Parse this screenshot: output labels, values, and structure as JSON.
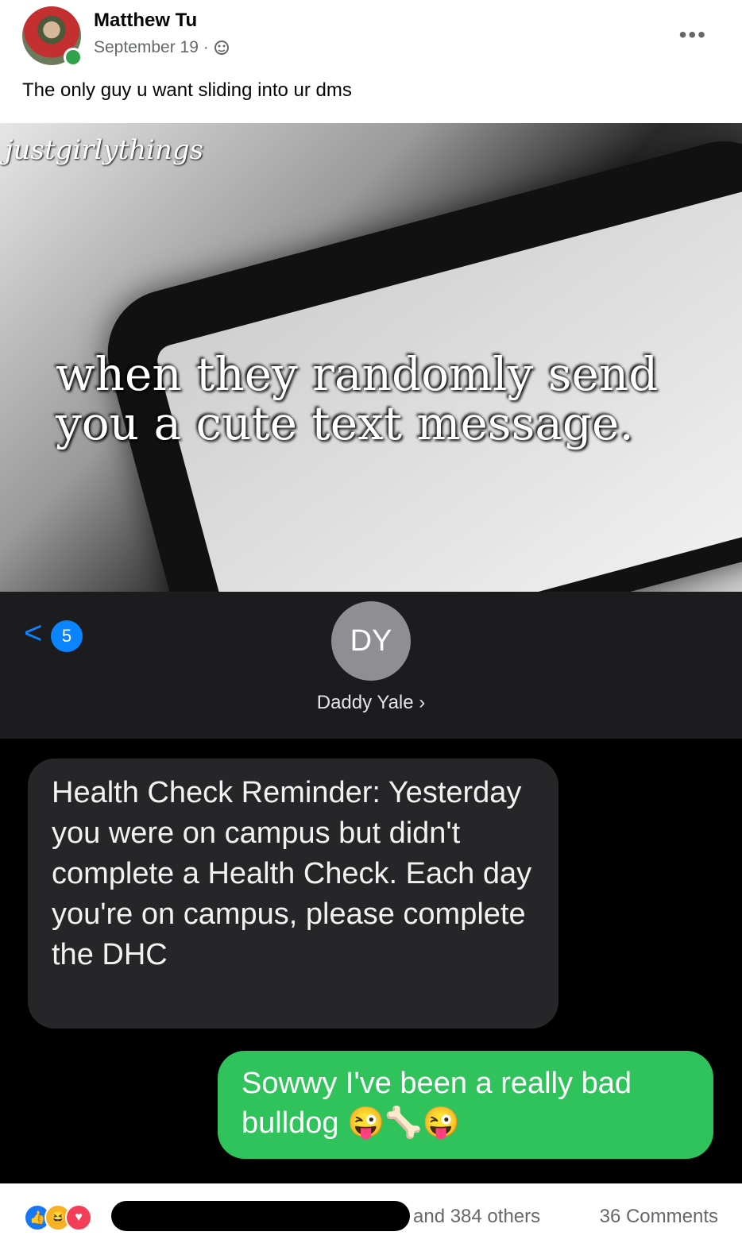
{
  "post": {
    "author": "Matthew Tu",
    "date": "September 19 ·",
    "caption": "The only guy u want sliding into ur dms",
    "more_label": "•••"
  },
  "meme": {
    "brand": "justgirlythings",
    "text": "when they randomly send you a cute text message."
  },
  "chat": {
    "back_glyph": "<",
    "unread_count": "5",
    "avatar_initials": "DY",
    "contact_name": "Daddy Yale ›",
    "incoming_message": "Health Check Reminder: Yesterday you were on campus but didn't complete a Health Check. Each day you're on campus, please complete the DHC",
    "outgoing_message": "Sowwy I've been a really bad bulldog 😜🦴😜"
  },
  "footer": {
    "reactions": [
      "like-icon",
      "haha-icon",
      "love-icon"
    ],
    "reaction_colors": [
      "#1877f2",
      "#f7b125",
      "#f33e58"
    ],
    "others_text": "and 384 others",
    "comments_text": "36 Comments"
  }
}
